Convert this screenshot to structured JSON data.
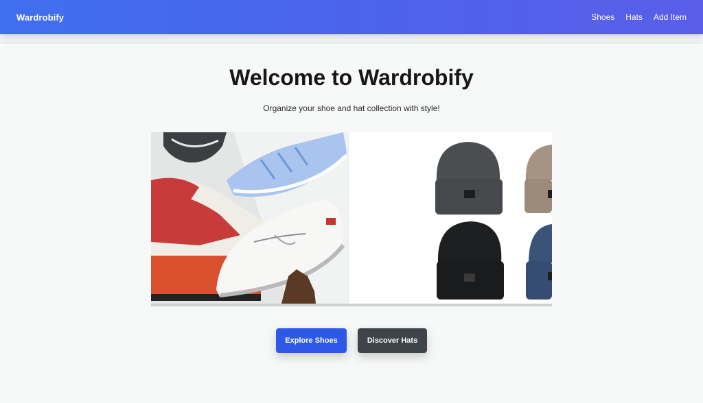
{
  "navbar": {
    "brand": "Wardrobify",
    "links": [
      {
        "label": "Shoes"
      },
      {
        "label": "Hats"
      },
      {
        "label": "Add Item"
      }
    ],
    "gradient_colors": [
      "#3f6fef",
      "#5a5ee8"
    ]
  },
  "hero": {
    "title": "Welcome to Wardrobify",
    "subtitle": "Organize your shoe and hat collection with style!"
  },
  "gallery": {
    "images": [
      {
        "name": "shoes-photo",
        "subject": "sneakers"
      },
      {
        "name": "hats-photo",
        "subject": "beanies"
      }
    ]
  },
  "actions": {
    "explore_shoes_label": "Explore Shoes",
    "discover_hats_label": "Discover Hats",
    "primary_color": "#2e58e8",
    "secondary_color": "#3e4449"
  }
}
